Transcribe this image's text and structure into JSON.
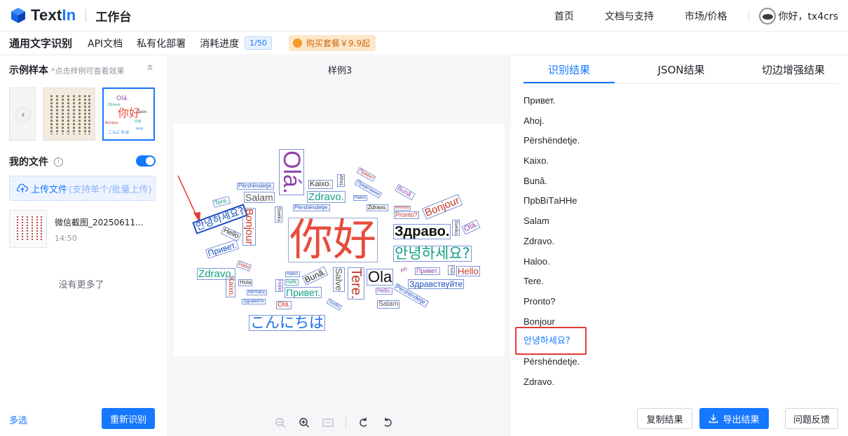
{
  "brand": {
    "logo_text_dark": "Text",
    "logo_text_blue": "In",
    "workbench": "工作台"
  },
  "topnav": {
    "home": "首页",
    "docs": "文档与支持",
    "market": "市场/价格",
    "greeting": "你好，tx4crs"
  },
  "subbar": {
    "title": "通用文字识别",
    "api_docs": "API文档",
    "private_deploy": "私有化部署",
    "usage_label": "消耗进度",
    "usage_value": "1/50",
    "promo": "购买套餐￥9.9起"
  },
  "left": {
    "samples_title": "示例样本",
    "samples_hint": "*点击样例可查看效果",
    "my_files": "我的文件",
    "upload_label": "上传文件",
    "upload_hint": "(支持单个/批量上传)",
    "file": {
      "name": "微信截图_20250611...",
      "time": "14:50"
    },
    "no_more": "没有更多了",
    "multi_select": "多选",
    "rerun": "重新识别"
  },
  "center": {
    "title": "样例3",
    "cloud_words": {
      "ola_big": "Olá.",
      "nihao": "你好",
      "zdravo_ru": "Здраво.",
      "annyeong_big": "안녕하세요?",
      "konnichiwa": "こんにちは",
      "annyeong_small": "안녕하세요?",
      "bonjour_v": "Bonjour",
      "salam": "Salam",
      "pershendetje1": "Përshëndetje.",
      "tere_small": "Tere.",
      "hello1": "Hello",
      "privet1": "Привет.",
      "zdravo1": "Zdravo.",
      "kaixo1": "Kaixo.",
      "zdravo2": "Zdravo.",
      "kaixo_v": "Kaixo.",
      "hola": "Hola",
      "halo": "Halo",
      "merhaba": "Merhaba.",
      "zdravee": "Здравейте",
      "ola_small": "Olá.",
      "privet2": "Привет.",
      "buna": "Bună.",
      "salve": "Salve",
      "tere_v": "Tere.",
      "ola_main": "Ola",
      "hello2": "Hello",
      "zdravstvuyte": "Здравствуйте",
      "privet3": "Привет.",
      "bonjour2": "Bonjour",
      "pronto": "Pronto?",
      "ahoj": "Ahoj.",
      "privet4": "Привет",
      "privitannya": "Привітання",
      "buna2": "Bună.",
      "sveiks": "Sveiks",
      "pershendetje2": "Përshëndetje.",
      "haloo": "Haloo",
      "zdravo3": "Zdravo.",
      "merhaba2": "Merhaba",
      "ola_right": "Olá.",
      "salam2": "Salam",
      "hello3": "Hello.",
      "pershendetje3": "Përshëndetje.",
      "sveiks2": "Sveiks",
      "salve2": "Salve",
      "halo2": "Halló",
      "hallo": "Hallo",
      "alo": "Aló.",
      "haloo2": "Haloo.",
      "halk": "Hallk",
      "pronto2": "Pronto?",
      "halo3": "Halo",
      "sveiks3": "Sveiks"
    }
  },
  "right": {
    "tabs": [
      "识别结果",
      "JSON结果",
      "切边增强结果"
    ],
    "results": [
      "Привет.",
      "Ahoj.",
      "Përshëndetje.",
      "Kaixo.",
      "Bună.",
      "ПрbВiТaHHe",
      "Salam",
      "Zdravo.",
      "Haloo.",
      "Tere.",
      "Pronto?",
      "Bonjour",
      "안녕하세요?",
      "Përshëndetje.",
      "Zdravo."
    ],
    "copy": "复制结果",
    "export": "导出结果",
    "feedback": "问题反馈"
  },
  "colors": {
    "accent": "#1677ff",
    "highlight_box": "#e53935",
    "promo_bg": "#fde7c8"
  }
}
